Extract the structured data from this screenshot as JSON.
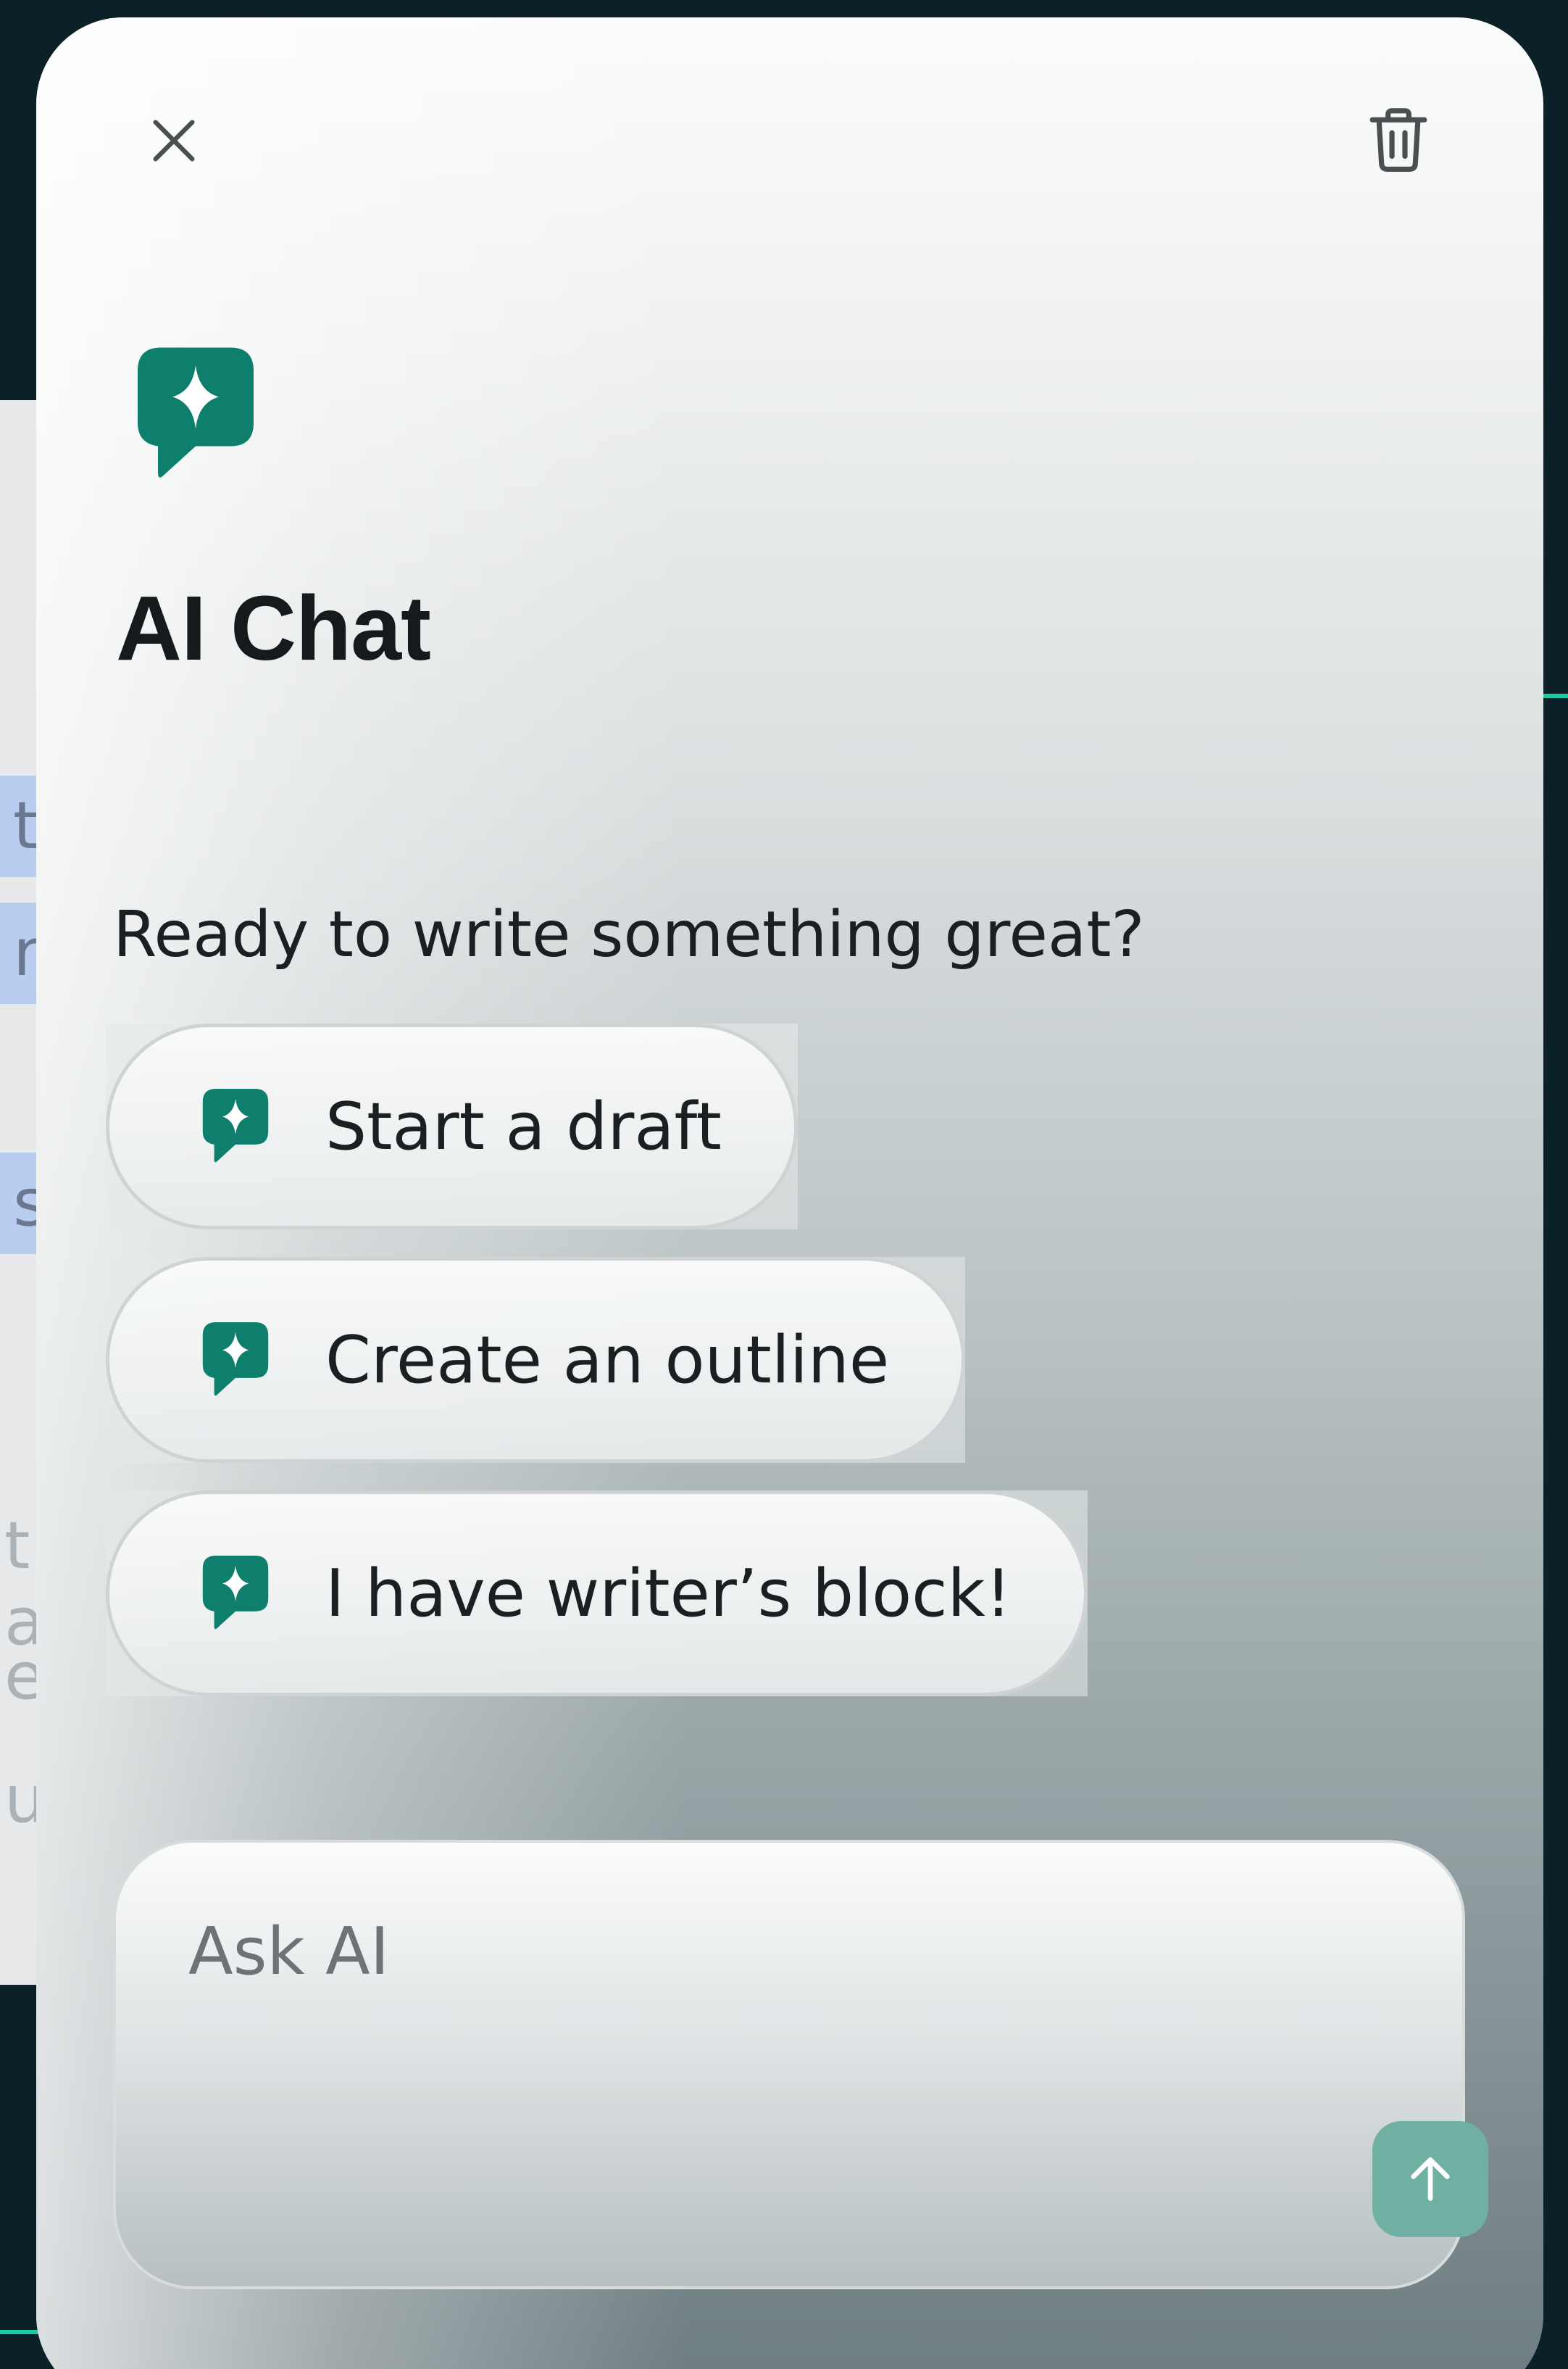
{
  "panel": {
    "title": "AI Chat",
    "subtitle": "Ready to write something great?"
  },
  "suggestions": [
    {
      "label": "Start a draft"
    },
    {
      "label": "Create an outline"
    },
    {
      "label": "I have writer’s block!"
    }
  ],
  "composer": {
    "placeholder": "Ask AI"
  },
  "background_fragments": [
    "t",
    "nt",
    "s",
    "t a",
    "ec",
    "u"
  ],
  "icons": {
    "close": "close-icon",
    "trash": "trash-icon",
    "logo": "sparkle-chat-icon",
    "send": "arrow-up-icon"
  },
  "colors": {
    "brand": "#0e7e6d",
    "send_button": "#6fb0a2",
    "accent_line": "#1fc9a6"
  }
}
